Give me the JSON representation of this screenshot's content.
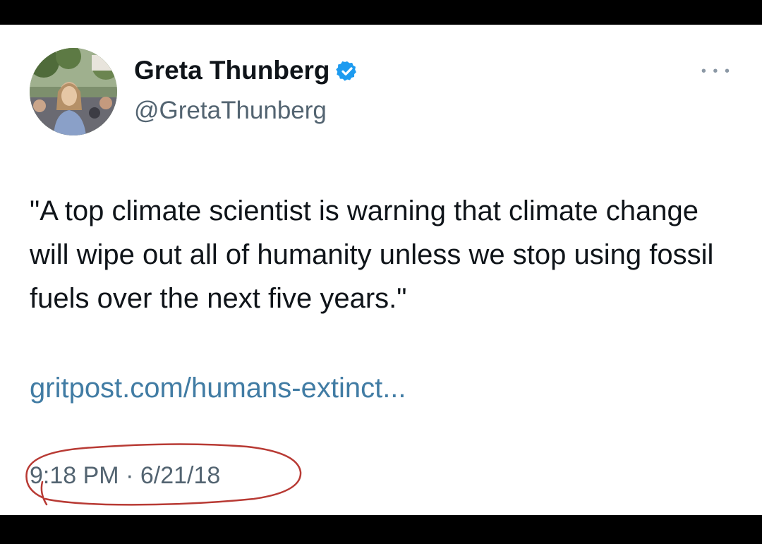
{
  "tweet": {
    "display_name": "Greta Thunberg",
    "handle": "@GretaThunberg",
    "verified": true,
    "text": "\"A top climate scientist is warning that climate change will wipe out all of humanity unless we stop using fossil fuels over the next five years.\"",
    "link": "gritpost.com/humans-extinct...",
    "timestamp": "9:18 PM · 6/21/18",
    "more_icon": "more-icon"
  },
  "colors": {
    "verified_badge": "#1d9bf0",
    "link": "#3b8dc2",
    "annotation_circle": "#b83a34",
    "text": "#0f1419",
    "secondary_text": "#536471"
  }
}
